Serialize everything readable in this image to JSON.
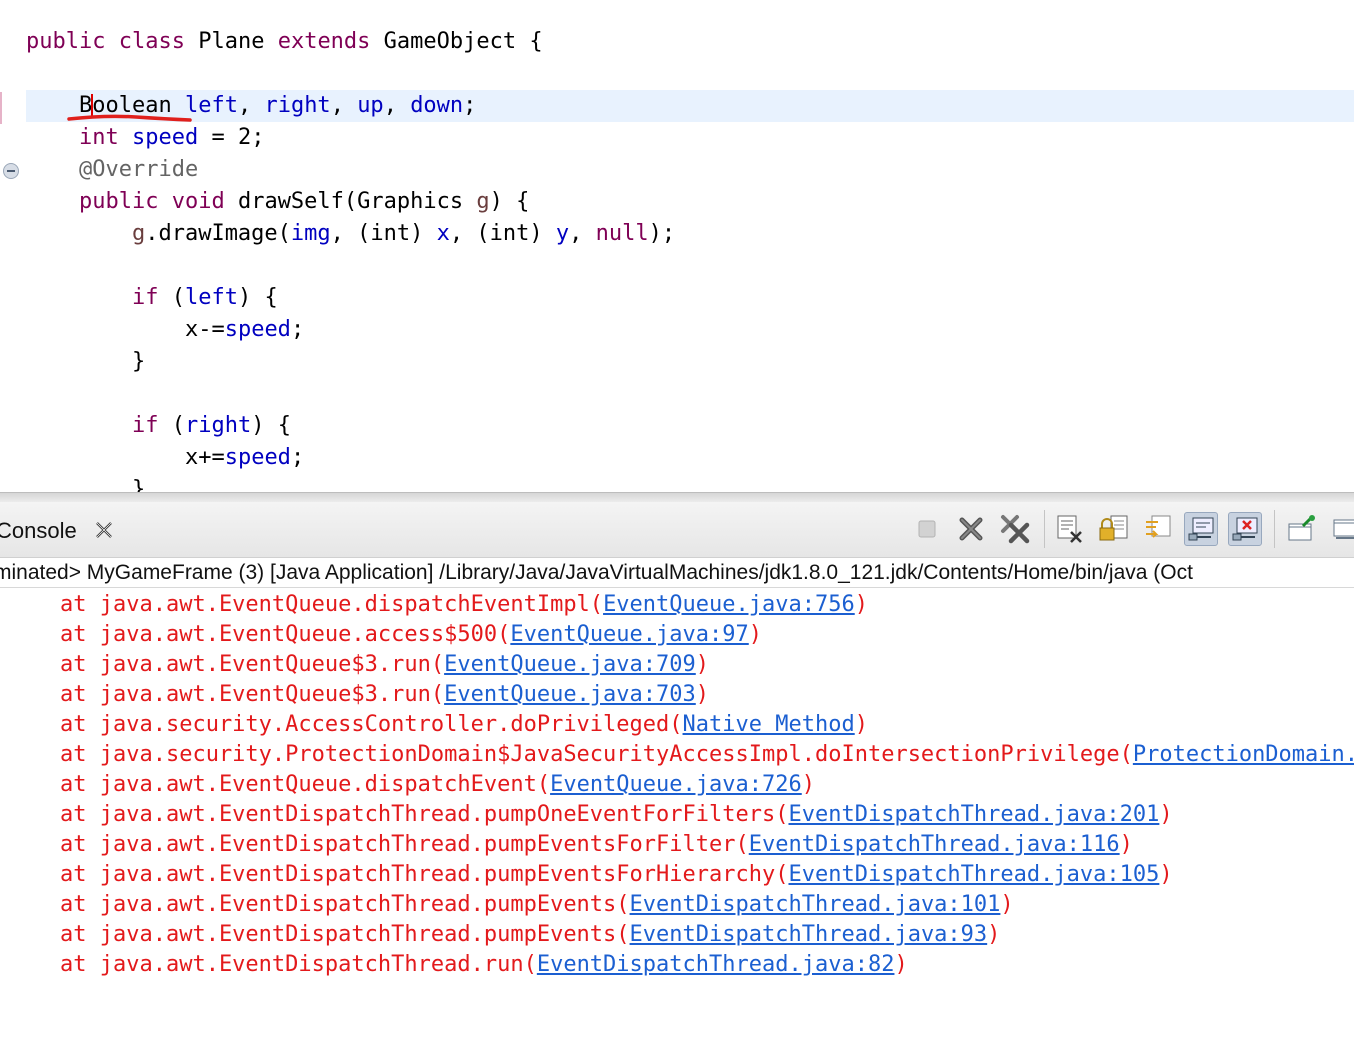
{
  "editor": {
    "line1": {
      "kw1": "public",
      "kw2": "class",
      "name": "Plane",
      "kw3": "extends",
      "parent": "GameObject",
      "brace": "{"
    },
    "line2": {
      "type_a": "B",
      "type_b": "oolean",
      "f1": "left",
      "f2": "right",
      "f3": "up",
      "f4": "down"
    },
    "line3": {
      "type": "int",
      "field": "speed",
      "rest": " = 2;"
    },
    "line4": {
      "annotation": "@Override"
    },
    "line5": {
      "kw1": "public",
      "kw2": "void",
      "method": "drawSelf(Graphics ",
      "param": "g",
      "rest": ") {"
    },
    "line6": {
      "var": "g",
      "call": ".drawImage(",
      "img": "img",
      "cast1": "(int)",
      "x": "x",
      "cast2": "(int)",
      "y": "y",
      "nul": "null",
      "end": ");"
    },
    "line7": {
      "kw": "if",
      "open": " (",
      "cond": "left",
      "close": ") {"
    },
    "line8": {
      "pre": "x-=",
      "field": "speed",
      "end": ";"
    },
    "line9": {
      "brace": "}"
    },
    "line10": {
      "kw": "if",
      "open": " (",
      "cond": "right",
      "close": ") {"
    },
    "line11": {
      "pre": "x+=",
      "field": "speed",
      "end": ";"
    },
    "line12": {
      "brace": "}"
    }
  },
  "console": {
    "tab_label": "Console",
    "title": "minated> MyGameFrame (3) [Java Application] /Library/Java/JavaVirtualMachines/jdk1.8.0_121.jdk/Contents/Home/bin/java (Oct",
    "trace": [
      {
        "text": "at java.awt.EventQueue.dispatchEventImpl(",
        "link": "EventQueue.java:756",
        "end": ")"
      },
      {
        "text": "at java.awt.EventQueue.access$500(",
        "link": "EventQueue.java:97",
        "end": ")"
      },
      {
        "text": "at java.awt.EventQueue$3.run(",
        "link": "EventQueue.java:709",
        "end": ")"
      },
      {
        "text": "at java.awt.EventQueue$3.run(",
        "link": "EventQueue.java:703",
        "end": ")"
      },
      {
        "text": "at java.security.AccessController.doPrivileged(",
        "link": "Native Method",
        "end": ")"
      },
      {
        "text": "at java.security.ProtectionDomain$JavaSecurityAccessImpl.doIntersectionPrivilege(",
        "link": "ProtectionDomain.",
        "end": ""
      },
      {
        "text": "at java.awt.EventQueue.dispatchEvent(",
        "link": "EventQueue.java:726",
        "end": ")"
      },
      {
        "text": "at java.awt.EventDispatchThread.pumpOneEventForFilters(",
        "link": "EventDispatchThread.java:201",
        "end": ")"
      },
      {
        "text": "at java.awt.EventDispatchThread.pumpEventsForFilter(",
        "link": "EventDispatchThread.java:116",
        "end": ")"
      },
      {
        "text": "at java.awt.EventDispatchThread.pumpEventsForHierarchy(",
        "link": "EventDispatchThread.java:105",
        "end": ")"
      },
      {
        "text": "at java.awt.EventDispatchThread.pumpEvents(",
        "link": "EventDispatchThread.java:101",
        "end": ")"
      },
      {
        "text": "at java.awt.EventDispatchThread.pumpEvents(",
        "link": "EventDispatchThread.java:93",
        "end": ")"
      },
      {
        "text": "at java.awt.EventDispatchThread.run(",
        "link": "EventDispatchThread.java:82",
        "end": ")"
      }
    ]
  },
  "toolbar": {
    "icons": [
      "terminate-icon",
      "remove-launch-icon",
      "remove-all-terminated-icon",
      "clear-console-icon",
      "scroll-lock-icon",
      "word-wrap-icon",
      "show-on-stdout-icon",
      "show-on-stderr-icon",
      "pin-console-icon",
      "new-console-icon"
    ]
  }
}
